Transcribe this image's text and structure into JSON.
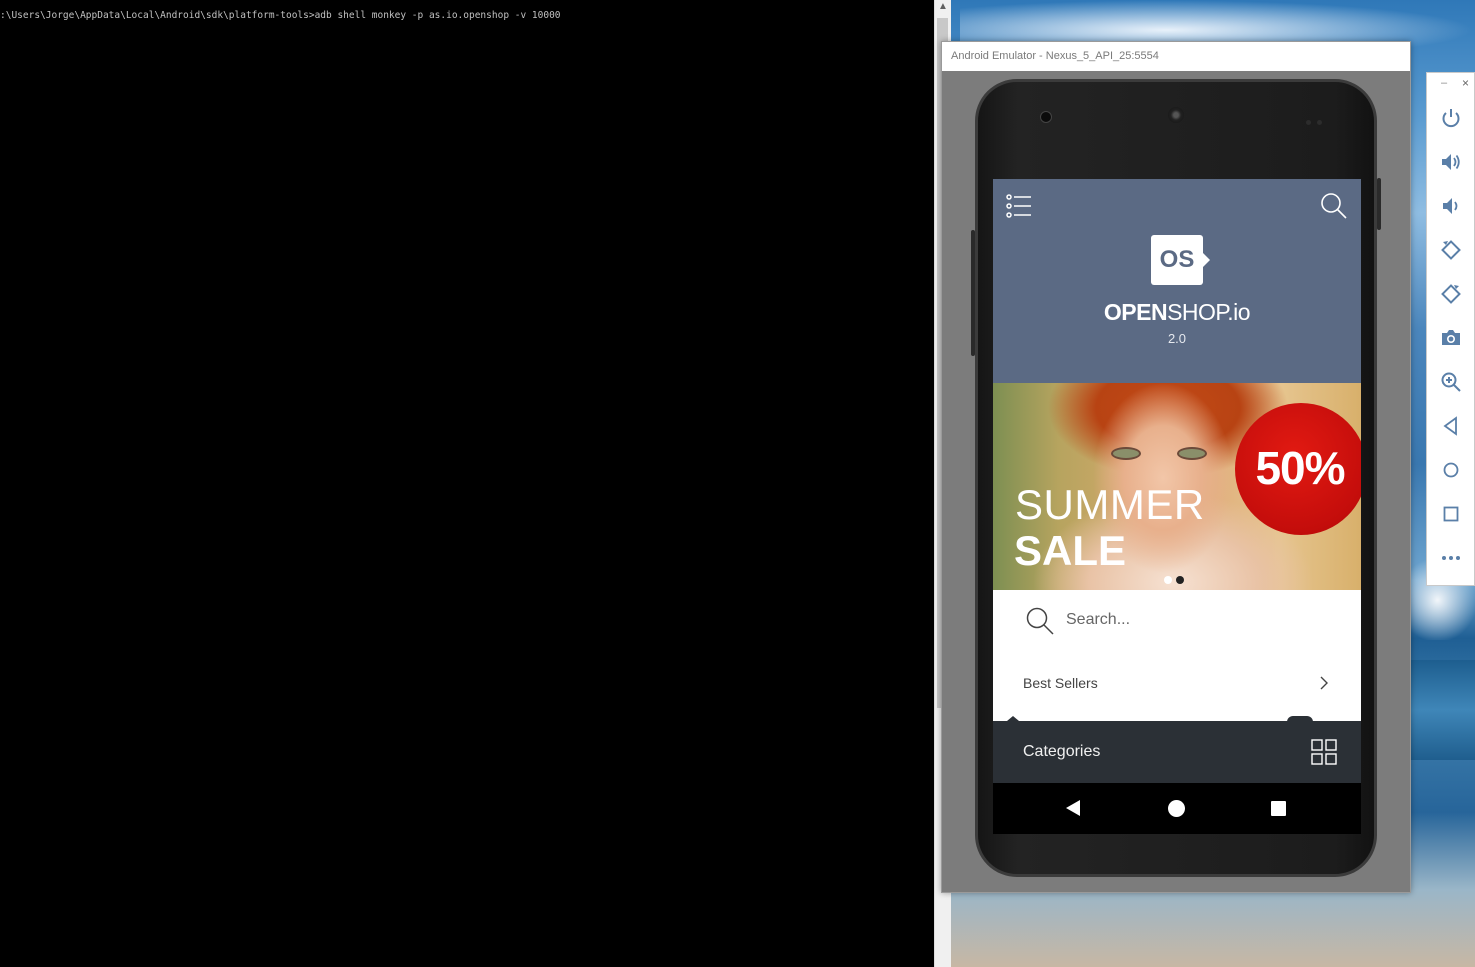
{
  "console": {
    "command_line": ":\\Users\\Jorge\\AppData\\Local\\Android\\sdk\\platform-tools>adb shell monkey -p as.io.openshop -v 10000"
  },
  "emulator": {
    "title": "Android Emulator - Nexus_5_API_25:5554"
  },
  "app": {
    "logo_text": "OS",
    "brand_bold": "OPEN",
    "brand_light": "SHOP.io",
    "version": "2.0",
    "banner": {
      "line1": "SUMMER",
      "line2": "SALE",
      "badge": "50%",
      "slides": 2,
      "active_slide": 2
    },
    "search_placeholder": "Search...",
    "best_sellers_label": "Best Sellers",
    "categories_label": "Categories"
  },
  "toolbar": {
    "minimize": "–",
    "close": "×",
    "buttons": [
      "power-icon",
      "volume-up-icon",
      "volume-down-icon",
      "rotate-left-icon",
      "rotate-right-icon",
      "camera-icon",
      "zoom-icon",
      "back-icon",
      "home-icon",
      "overview-icon",
      "more-icon"
    ]
  },
  "colors": {
    "appbar": "#5b6a84",
    "badge": "#d3120e",
    "categories_bar": "#2b3036",
    "toolbar_icon": "#5a7fa8"
  }
}
